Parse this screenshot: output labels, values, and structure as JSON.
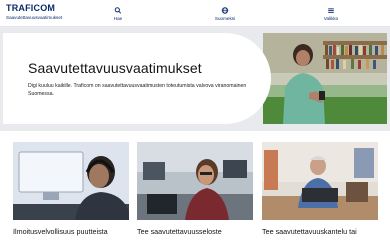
{
  "header": {
    "logo_text": "TRAFICOM",
    "logo_sub": "Saavutettavuusvaatimukset",
    "nav": [
      {
        "label": "Hae",
        "icon": "search-icon"
      },
      {
        "label": "Suomeksi",
        "icon": "globe-icon"
      },
      {
        "label": "Valikko",
        "icon": "menu-icon"
      }
    ]
  },
  "hero": {
    "title": "Saavutettavuusvaatimukset",
    "description": "Digi kuuluu kaikille. Traficom on saavutettavuusvaatimusten toteutumista valvova viranomainen Suomessa."
  },
  "cards": [
    {
      "title": "Ilmoitusvelvollisuus puutteista"
    },
    {
      "title": "Tee saavutettavuusseloste"
    },
    {
      "title": "Tee saavutettavuuskantelu tai"
    }
  ],
  "colors": {
    "brand": "#0b2b6b",
    "band": "#e8eaee"
  }
}
